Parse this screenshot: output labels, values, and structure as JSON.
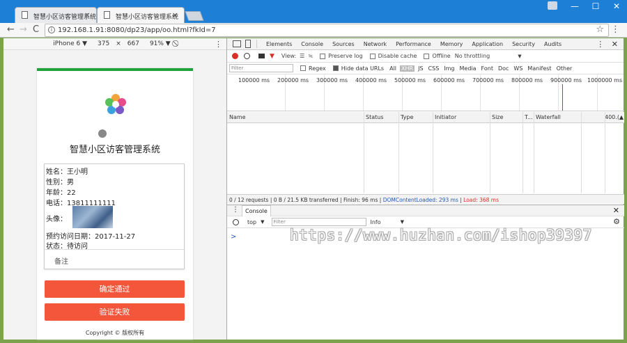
{
  "browser": {
    "tabs": [
      {
        "title": "智慧小区访客管理系统",
        "close": "×"
      },
      {
        "title": "智慧小区访客管理系统",
        "close": "×"
      }
    ],
    "window_buttons": [
      "—",
      "☐",
      "✕"
    ],
    "nav": {
      "back": "←",
      "forward": "→",
      "reload": "C"
    },
    "url": "192.168.1.91:8080/dp23/app/oo.html?fkId=7",
    "bookmark_icon": "star-icon"
  },
  "device_toolbar": {
    "device": "iPhone 6 ▼",
    "width": "375",
    "times": "×",
    "height": "667",
    "zoom": "91% ▼",
    "rotate_icon": "rotate-icon"
  },
  "app": {
    "title": "智慧小区访客管理系统",
    "fields": {
      "name": "姓名：王小明",
      "gender": "性别：男",
      "age": "年龄：22",
      "phone": "电话：13811111111",
      "avatar_label": "头像：",
      "visit_date": "预约访问日期：2017-11-27",
      "status": "状态：待访问"
    },
    "remark_placeholder": "备注",
    "approve_button": "确定通过",
    "reject_button": "验证失败",
    "copyright": "Copyright © 版权所有"
  },
  "devtools": {
    "tabs": [
      "Elements",
      "Console",
      "Sources",
      "Network",
      "Performance",
      "Memory",
      "Application",
      "Security",
      "Audits"
    ],
    "row2": {
      "view": "View:",
      "preserve_log": "Preserve log",
      "disable_cache": "Disable cache",
      "offline": "Offline",
      "throttling": "No throttling",
      "dropdown": "▼"
    },
    "filter_placeholder": "Filter",
    "regex": "Regex",
    "hide_data_urls": "Hide data URLs",
    "types": [
      "All",
      "XHR",
      "JS",
      "CSS",
      "Img",
      "Media",
      "Font",
      "Doc",
      "WS",
      "Manifest",
      "Other"
    ],
    "timeline_labels": [
      "100000 ms",
      "200000 ms",
      "300000 ms",
      "400000 ms",
      "500000 ms",
      "600000 ms",
      "700000 ms",
      "800000 ms",
      "900000 ms",
      "1000000 ms"
    ],
    "columns": [
      "Name",
      "Status",
      "Type",
      "Initiator",
      "Size",
      "T...",
      "Waterfall",
      "400.(▲"
    ],
    "summary": {
      "requests": "0 / 12 requests",
      "transferred": "0 B / 21.5 KB transferred",
      "finish": "Finish: 96 ms",
      "dcl": "DOMContentLoaded: 293 ms",
      "load": "Load: 368 ms",
      "sep": "|"
    },
    "console": {
      "tab": "Console",
      "context": "top",
      "dropdown": "▼",
      "filter_placeholder": "Filter",
      "level": "Info",
      "prompt": ">"
    }
  },
  "watermark": "https://www.huzhan.com/ishop39397"
}
